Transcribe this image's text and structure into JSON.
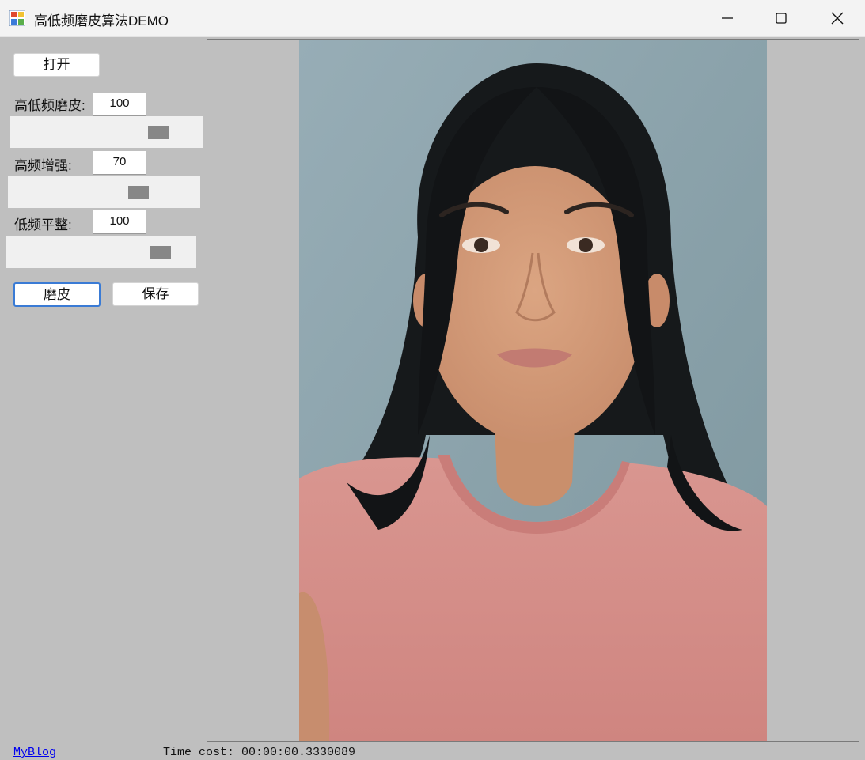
{
  "window": {
    "title": "高低频磨皮算法DEMO",
    "icon": "app-icon",
    "controls": [
      "minimize-icon",
      "maximize-icon",
      "close-icon"
    ]
  },
  "panel": {
    "open_label": "打开",
    "param1": {
      "label": "高低频磨皮:",
      "value": "100",
      "slider_level": 0.8
    },
    "param2": {
      "label": "高频增强:",
      "value": "70",
      "slider_level": 0.7
    },
    "param3": {
      "label": "低频平整:",
      "value": "100",
      "slider_level": 0.85
    },
    "smooth_label": "磨皮",
    "save_label": "保存"
  },
  "footer": {
    "link_text": "MyBlog",
    "status_text": "Time cost: 00:00:00.3330089"
  },
  "colors": {
    "panel_bg": "#bfbfbf",
    "titlebar_bg": "#f3f3f3",
    "accent": "#3a7bd5",
    "photo_background": "#92aab3",
    "shirt": "#d88c88",
    "hair": "#17191a",
    "skin": "#d49c79"
  },
  "photo": {
    "content": "portrait-photo"
  }
}
